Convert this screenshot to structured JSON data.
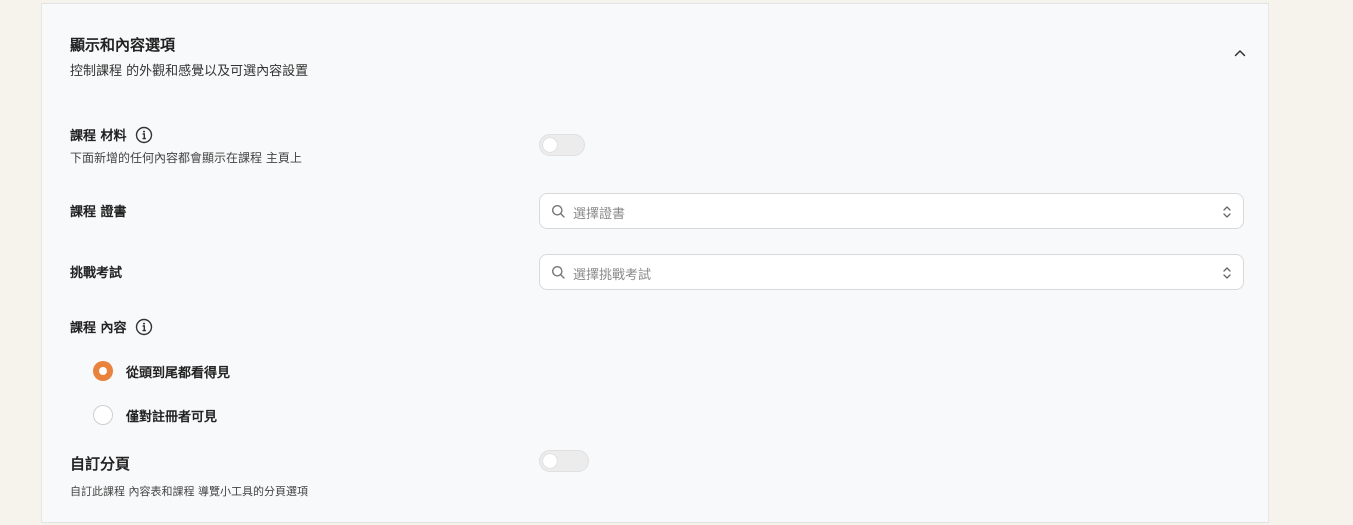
{
  "section": {
    "title": "顯示和內容選項",
    "subtitle": "控制課程 的外觀和感覺以及可選內容設置"
  },
  "materials": {
    "label": "課程 材料",
    "description": "下面新增的任何內容都會顯示在課程 主頁上",
    "enabled": false
  },
  "certificate": {
    "label": "課程 證書",
    "placeholder": "選擇證書"
  },
  "challenge_exam": {
    "label": "挑戰考試",
    "placeholder": "選擇挑戰考試"
  },
  "content": {
    "label": "課程 內容",
    "options": [
      {
        "label": "從頭到尾都看得見",
        "checked": true
      },
      {
        "label": "僅對註冊者可見",
        "checked": false
      }
    ]
  },
  "pagination": {
    "label": "自訂分頁",
    "description": "自訂此課程 內容表和課程 導覽小工具的分頁選項",
    "enabled": false
  },
  "colors": {
    "accent": "#e9823c",
    "panel_bg": "#f8f9fa",
    "page_bg": "#f6f3ec"
  }
}
